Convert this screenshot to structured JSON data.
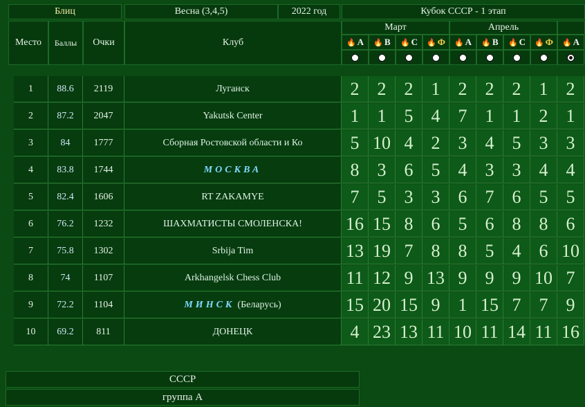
{
  "header": {
    "mode": "Блиц",
    "season": "Весна (3,4,5)",
    "year": "2022 год",
    "cup": "Кубок СССР - 1 этап",
    "col_place": "Место",
    "col_balls": "Баллы",
    "col_points": "Очки",
    "col_club": "Клуб",
    "month_march": "Март",
    "month_april": "Апрель",
    "rounds": [
      {
        "letter": "А",
        "icon": "flame-icon",
        "selected": false
      },
      {
        "letter": "В",
        "icon": "flame-icon",
        "selected": false
      },
      {
        "letter": "С",
        "icon": "flame-icon",
        "selected": false
      },
      {
        "letter": "Ф",
        "icon": "flame-icon",
        "selected": false
      },
      {
        "letter": "А",
        "icon": "flame-icon",
        "selected": false
      },
      {
        "letter": "В",
        "icon": "flame-icon",
        "selected": false
      },
      {
        "letter": "С",
        "icon": "flame-icon",
        "selected": false
      },
      {
        "letter": "Ф",
        "icon": "flame-icon",
        "selected": false
      },
      {
        "letter": "А",
        "icon": "flame-icon",
        "selected": true
      }
    ]
  },
  "rows": [
    {
      "place": "1",
      "balls": "88.6",
      "points": "2119",
      "club": "Луганск",
      "special": false,
      "sub": "",
      "results": [
        "2",
        "2",
        "2",
        "1",
        "2",
        "2",
        "2",
        "1",
        "2"
      ]
    },
    {
      "place": "2",
      "balls": "87.2",
      "points": "2047",
      "club": "Yakutsk Center",
      "special": false,
      "sub": "",
      "results": [
        "1",
        "1",
        "5",
        "4",
        "7",
        "1",
        "1",
        "2",
        "1"
      ]
    },
    {
      "place": "3",
      "balls": "84",
      "points": "1777",
      "club": "Сборная Ростовской области и Ко",
      "special": false,
      "sub": "",
      "results": [
        "5",
        "10",
        "4",
        "2",
        "3",
        "4",
        "5",
        "3",
        "3"
      ]
    },
    {
      "place": "4",
      "balls": "83.8",
      "points": "1744",
      "club": "МОСКВА",
      "special": true,
      "sub": "",
      "results": [
        "8",
        "3",
        "6",
        "5",
        "4",
        "3",
        "3",
        "4",
        "4"
      ]
    },
    {
      "place": "5",
      "balls": "82.4",
      "points": "1606",
      "club": "RT ZAKAMYE",
      "special": false,
      "sub": "",
      "results": [
        "7",
        "5",
        "3",
        "3",
        "6",
        "7",
        "6",
        "5",
        "5"
      ]
    },
    {
      "place": "6",
      "balls": "76.2",
      "points": "1232",
      "club": "ШАХМАТИСТЫ СМОЛЕНСКА!",
      "special": false,
      "sub": "",
      "results": [
        "16",
        "15",
        "8",
        "6",
        "5",
        "6",
        "8",
        "8",
        "6"
      ]
    },
    {
      "place": "7",
      "balls": "75.8",
      "points": "1302",
      "club": "Srbija Tim",
      "special": false,
      "sub": "",
      "results": [
        "13",
        "19",
        "7",
        "8",
        "8",
        "5",
        "4",
        "6",
        "10"
      ]
    },
    {
      "place": "8",
      "balls": "74",
      "points": "1107",
      "club": "Arkhangelsk Chess Club",
      "special": false,
      "sub": "",
      "results": [
        "11",
        "12",
        "9",
        "13",
        "9",
        "9",
        "9",
        "10",
        "7"
      ]
    },
    {
      "place": "9",
      "balls": "72.2",
      "points": "1104",
      "club": "МИНСК",
      "special": true,
      "sub": "(Беларусь)",
      "results": [
        "15",
        "20",
        "15",
        "9",
        "1",
        "15",
        "7",
        "7",
        "9"
      ]
    },
    {
      "place": "10",
      "balls": "69.2",
      "points": "811",
      "club": "ДОНЕЦК",
      "special": false,
      "sub": "",
      "results": [
        "4",
        "23",
        "13",
        "11",
        "10",
        "11",
        "14",
        "11",
        "16"
      ]
    }
  ],
  "footer": {
    "league": "СССР",
    "group": "группа А"
  }
}
